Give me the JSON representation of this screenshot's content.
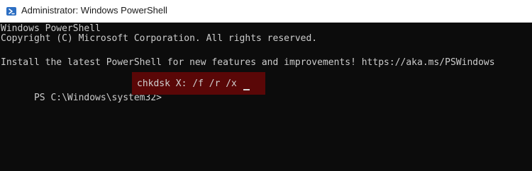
{
  "window": {
    "title": "Administrator: Windows PowerShell",
    "icon": "powershell-icon"
  },
  "terminal": {
    "header_line": "Windows PowerShell",
    "copyright_line": "Copyright (C) Microsoft Corporation. All rights reserved.",
    "install_line": "Install the latest PowerShell for new features and improvements! https://aka.ms/PSWindows",
    "prompt": "PS C:\\Windows\\system32>",
    "command": "chkdsk X: /f /r /x"
  },
  "colors": {
    "terminal_background": "#0c0c0c",
    "terminal_text": "#cccccc",
    "command_highlight": "#5a0707",
    "titlebar_background": "#ffffff"
  }
}
